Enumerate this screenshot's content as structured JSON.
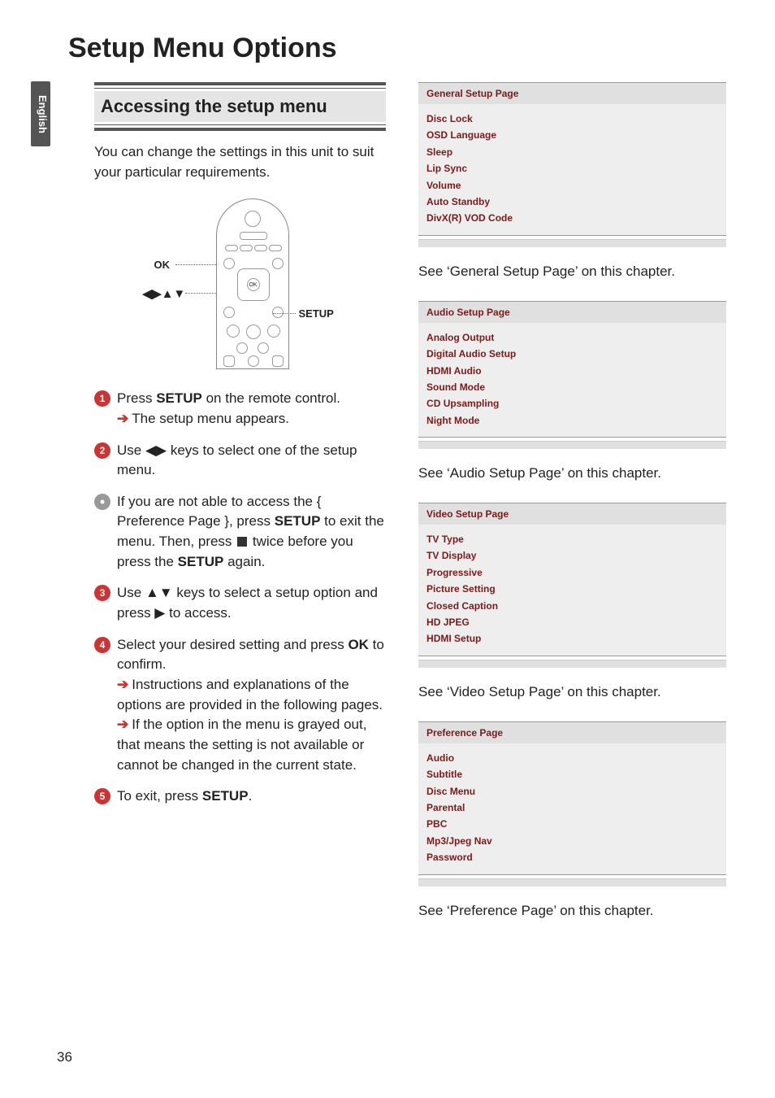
{
  "language_tab": "English",
  "page_title": "Setup Menu Options",
  "section_heading": "Accessing the setup menu",
  "intro": "You can change the settings in this unit to suit your particular requirements.",
  "diagram": {
    "label_ok": "OK",
    "label_arrows": "◀▶▲▼",
    "label_setup": "SETUP"
  },
  "steps": {
    "s1a": "Press ",
    "s1b": "SETUP",
    "s1c": " on the remote control.",
    "s1_sub": "The setup menu appears.",
    "s2": "Use ◀▶ keys to select one of the setup menu.",
    "bullet_a": "If you are not able to access the { Preference Page }, press ",
    "bullet_b": "SETUP",
    "bullet_c": " to exit the menu. Then, press ",
    "bullet_d": " twice before you press the ",
    "bullet_e": " again.",
    "s3": "Use ▲▼ keys to select a setup option and press ▶ to access.",
    "s4a": "Select your desired setting and press ",
    "s4b": "OK",
    "s4c": " to confirm.",
    "s4_sub1": "Instructions and explanations of the options are provided in the following pages.",
    "s4_sub2": "If the option in the menu is grayed out, that means the setting is not available or cannot be changed in the current state.",
    "s5a": "To exit, press ",
    "s5b": "SETUP",
    "s5c": "."
  },
  "menus": [
    {
      "title": "General Setup Page",
      "items": [
        "Disc Lock",
        "OSD Language",
        "Sleep",
        "Lip Sync",
        "Volume",
        "Auto Standby",
        "DivX(R) VOD Code"
      ],
      "see": "See ‘General Setup Page’ on this chapter."
    },
    {
      "title": "Audio Setup Page",
      "items": [
        "Analog Output",
        "Digital Audio Setup",
        "HDMI Audio",
        "Sound Mode",
        "CD Upsampling",
        "Night Mode"
      ],
      "see": "See ‘Audio Setup Page’ on this chapter."
    },
    {
      "title": "Video Setup Page",
      "items": [
        "TV Type",
        "TV Display",
        "Progressive",
        "Picture Setting",
        "Closed Caption",
        "HD JPEG",
        "HDMI Setup"
      ],
      "see": "See ‘Video Setup Page’ on this chapter."
    },
    {
      "title": "Preference Page",
      "items": [
        "Audio",
        "Subtitle",
        "Disc Menu",
        "Parental",
        "PBC",
        "Mp3/Jpeg Nav",
        "Password"
      ],
      "see": "See ‘Preference Page’ on this chapter."
    }
  ],
  "page_number": "36"
}
